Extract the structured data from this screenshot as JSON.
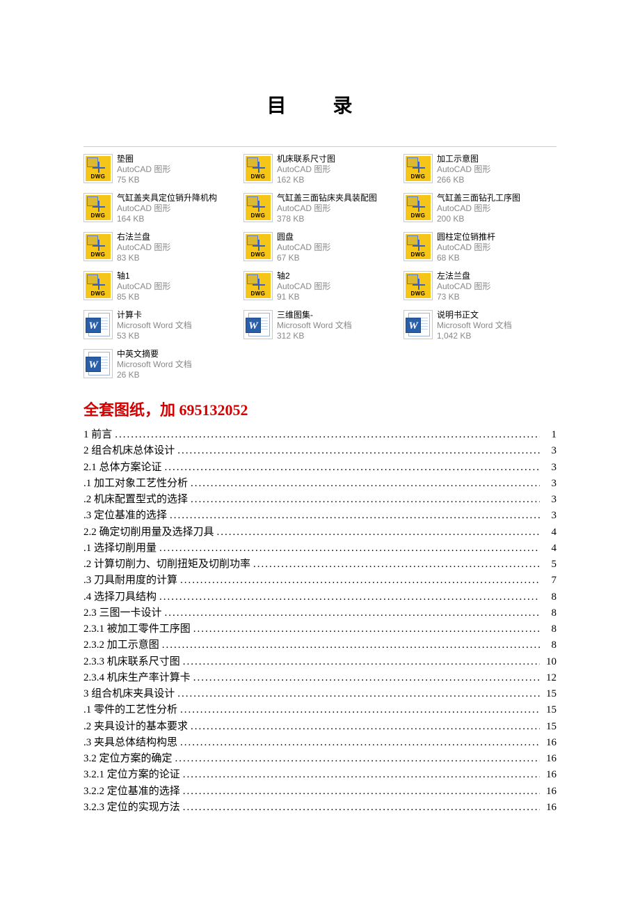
{
  "title": "目 录",
  "dwg_label": "DWG",
  "files": [
    {
      "icon": "dwg",
      "name": "垫圈",
      "type": "AutoCAD 图形",
      "size": "75 KB"
    },
    {
      "icon": "dwg",
      "name": "机床联系尺寸图",
      "type": "AutoCAD 图形",
      "size": "162 KB"
    },
    {
      "icon": "dwg",
      "name": "加工示意图",
      "type": "AutoCAD 图形",
      "size": "266 KB"
    },
    {
      "icon": "dwg",
      "name": "气缸盖夹具定位销升降机构",
      "type": "AutoCAD 图形",
      "size": "164 KB"
    },
    {
      "icon": "dwg",
      "name": "气缸盖三面钻床夹具装配图",
      "type": "AutoCAD 图形",
      "size": "378 KB"
    },
    {
      "icon": "dwg",
      "name": "气缸盖三面钻孔工序图",
      "type": "AutoCAD 图形",
      "size": "200 KB"
    },
    {
      "icon": "dwg",
      "name": "右法兰盘",
      "type": "AutoCAD 图形",
      "size": "83 KB"
    },
    {
      "icon": "dwg",
      "name": "圆盘",
      "type": "AutoCAD 图形",
      "size": "67 KB"
    },
    {
      "icon": "dwg",
      "name": "圆柱定位销推杆",
      "type": "AutoCAD 图形",
      "size": "68 KB"
    },
    {
      "icon": "dwg",
      "name": "轴1",
      "type": "AutoCAD 图形",
      "size": "85 KB"
    },
    {
      "icon": "dwg",
      "name": "轴2",
      "type": "AutoCAD 图形",
      "size": "91 KB"
    },
    {
      "icon": "dwg",
      "name": "左法兰盘",
      "type": "AutoCAD 图形",
      "size": "73 KB"
    },
    {
      "icon": "word",
      "name": "计算卡",
      "type": "Microsoft Word 文档",
      "size": "53 KB"
    },
    {
      "icon": "word",
      "name": "三维图集-",
      "type": "Microsoft Word 文档",
      "size": "312 KB"
    },
    {
      "icon": "word",
      "name": "说明书正文",
      "type": "Microsoft Word 文档",
      "size": "1,042 KB"
    },
    {
      "icon": "word",
      "name": "中英文摘要",
      "type": "Microsoft Word 文档",
      "size": "26 KB"
    }
  ],
  "red_heading": "全套图纸，加 695132052",
  "toc": [
    {
      "label": "1 前言",
      "page": "1"
    },
    {
      "label": "2 组合机床总体设计",
      "page": "3"
    },
    {
      "label": "2.1 总体方案论证",
      "page": "3"
    },
    {
      "label": ".1 加工对象工艺性分析",
      "page": "3"
    },
    {
      "label": ".2 机床配置型式的选择",
      "page": "3"
    },
    {
      "label": ".3 定位基准的选择",
      "page": "3"
    },
    {
      "label": "2.2 确定切削用量及选择刀具",
      "page": "4"
    },
    {
      "label": ".1 选择切削用量",
      "page": "4"
    },
    {
      "label": ".2 计算切削力、切削扭矩及切削功率",
      "page": "5"
    },
    {
      "label": ".3 刀具耐用度的计算",
      "page": "7"
    },
    {
      "label": ".4 选择刀具结构",
      "page": "8"
    },
    {
      "label": "2.3 三图一卡设计",
      "page": "8"
    },
    {
      "label": "2.3.1 被加工零件工序图",
      "page": "8"
    },
    {
      "label": "2.3.2 加工示意图",
      "page": "8"
    },
    {
      "label": "2.3.3 机床联系尺寸图",
      "page": "10"
    },
    {
      "label": "2.3.4 机床生产率计算卡",
      "page": "12"
    },
    {
      "label": "3 组合机床夹具设计",
      "page": "15"
    },
    {
      "label": ".1 零件的工艺性分析",
      "page": "15"
    },
    {
      "label": ".2 夹具设计的基本要求",
      "page": "15"
    },
    {
      "label": ".3 夹具总体结构构思",
      "page": "16"
    },
    {
      "label": "3.2 定位方案的确定",
      "page": "16"
    },
    {
      "label": "3.2.1 定位方案的论证",
      "page": "16"
    },
    {
      "label": "3.2.2 定位基准的选择",
      "page": "16"
    },
    {
      "label": "3.2.3 定位的实现方法",
      "page": "16"
    }
  ]
}
